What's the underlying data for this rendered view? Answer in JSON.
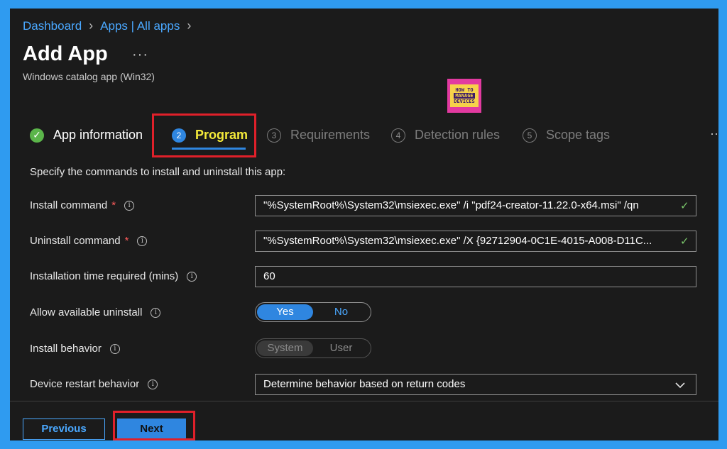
{
  "breadcrumb": {
    "items": [
      "Dashboard",
      "Apps | All apps"
    ]
  },
  "header": {
    "title": "Add App",
    "more_label": "···",
    "subtitle": "Windows catalog app (Win32)"
  },
  "logo": {
    "line1": "HOW TO",
    "line2": "MANAGE",
    "line3": "DEVICES"
  },
  "steps": [
    {
      "label": "App information",
      "state": "completed",
      "icon": "check-icon"
    },
    {
      "label": "Program",
      "number": "2",
      "state": "active"
    },
    {
      "label": "Requirements",
      "number": "3",
      "state": "inactive"
    },
    {
      "label": "Detection rules",
      "number": "4",
      "state": "inactive"
    },
    {
      "label": "Scope tags",
      "number": "5",
      "state": "inactive"
    }
  ],
  "steps_more": "··",
  "form": {
    "instructions": "Specify the commands to install and uninstall this app:",
    "install_command": {
      "label": "Install command",
      "required": "*",
      "value": "\"%SystemRoot%\\System32\\msiexec.exe\" /i \"pdf24-creator-11.22.0-x64.msi\" /qn",
      "valid_icon": "✓"
    },
    "uninstall_command": {
      "label": "Uninstall command",
      "required": "*",
      "value": "\"%SystemRoot%\\System32\\msiexec.exe\" /X {92712904-0C1E-4015-A008-D11C...",
      "valid_icon": "✓"
    },
    "install_time": {
      "label": "Installation time required (mins)",
      "value": "60"
    },
    "allow_uninstall": {
      "label": "Allow available uninstall",
      "options": [
        "Yes",
        "No"
      ],
      "selected": "Yes"
    },
    "install_behavior": {
      "label": "Install behavior",
      "options": [
        "System",
        "User"
      ],
      "selected": "System",
      "disabled": true
    },
    "restart_behavior": {
      "label": "Device restart behavior",
      "value": "Determine behavior based on return codes"
    }
  },
  "footer": {
    "previous_label": "Previous",
    "next_label": "Next"
  },
  "colors": {
    "accent": "#2f86e0",
    "link": "#4aa8ff",
    "highlight": "#e0202a",
    "success": "#5bb54a",
    "active_step_text": "#f4ea3a"
  }
}
